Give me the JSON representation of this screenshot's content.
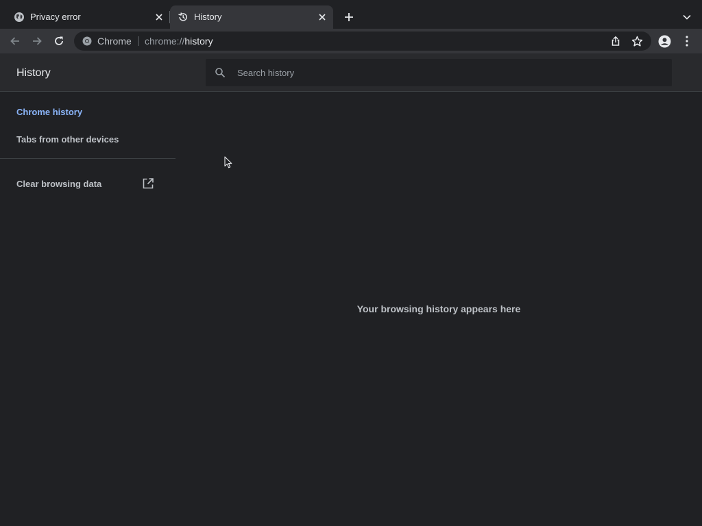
{
  "tabs": [
    {
      "title": "Privacy error",
      "icon": "globe-icon",
      "active": false
    },
    {
      "title": "History",
      "icon": "history-icon",
      "active": true
    }
  ],
  "omnibox": {
    "chip_label": "Chrome",
    "url_scheme": "chrome://",
    "url_host": "history"
  },
  "page": {
    "title": "History",
    "search_placeholder": "Search history",
    "empty_message": "Your browsing history appears here"
  },
  "sidebar": {
    "items": [
      {
        "label": "Chrome history",
        "selected": true
      },
      {
        "label": "Tabs from other devices",
        "selected": false
      }
    ],
    "clear_label": "Clear browsing data"
  },
  "colors": {
    "background": "#202124",
    "toolbar": "#35363a",
    "header": "#292a2d",
    "accent": "#8ab4f8",
    "text_secondary": "#bdc1c6"
  }
}
